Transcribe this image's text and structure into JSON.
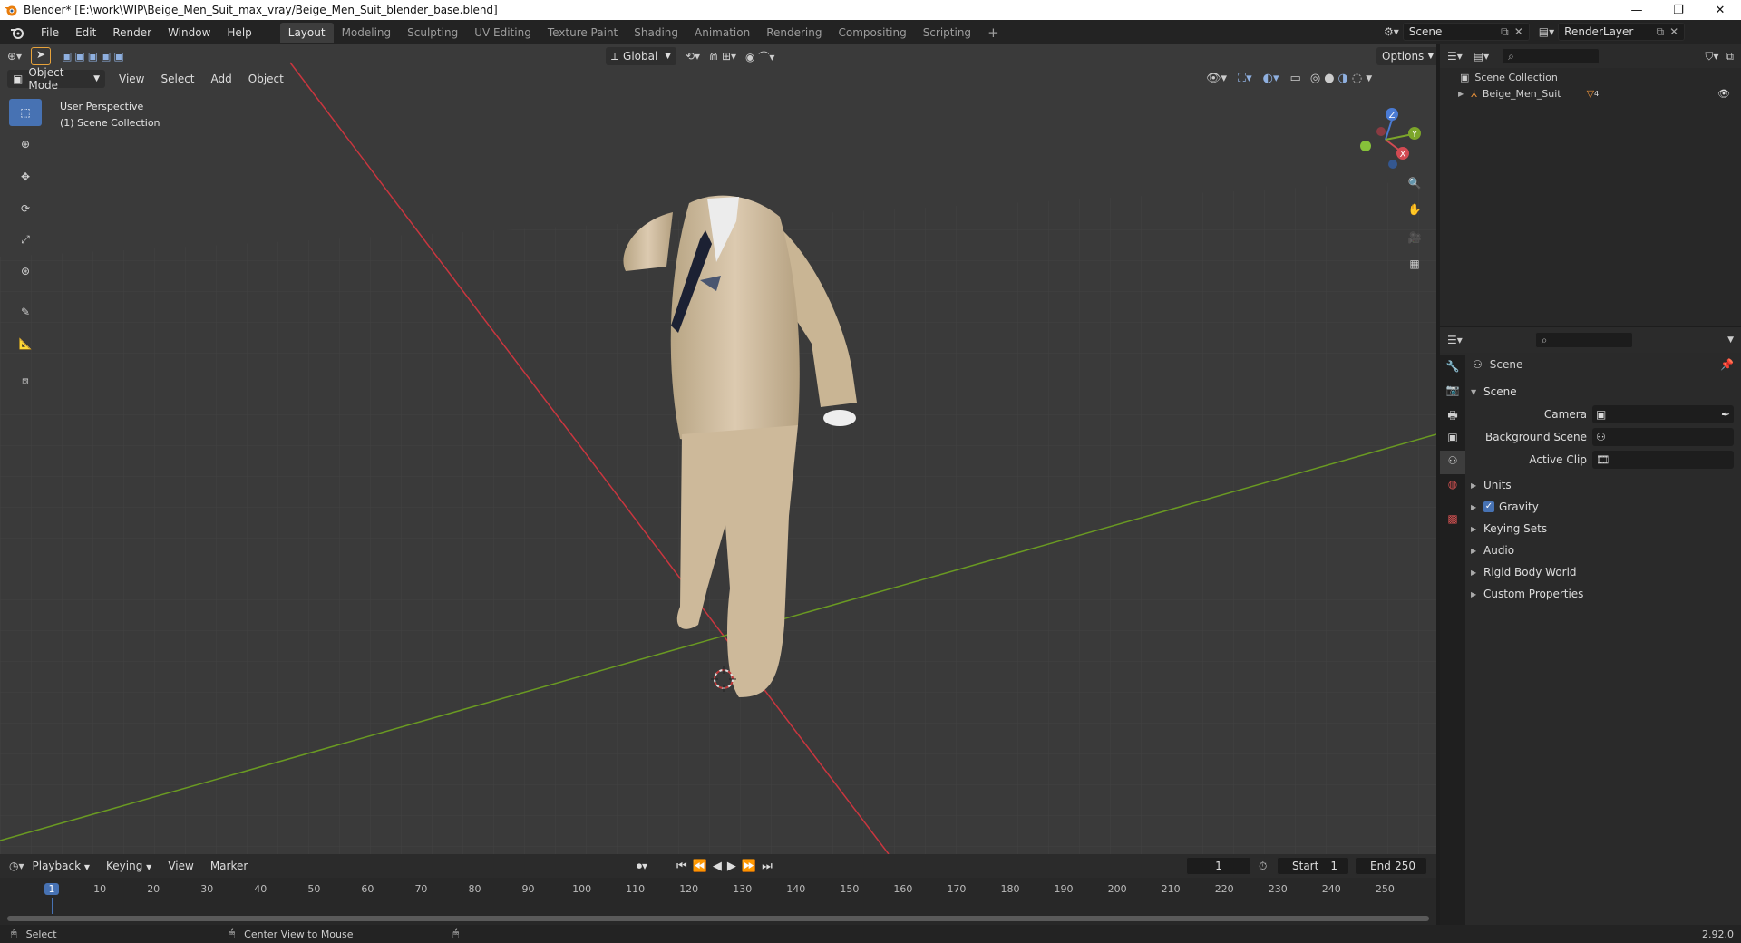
{
  "window": {
    "title": "Blender* [E:\\work\\WIP\\Beige_Men_Suit_max_vray/Beige_Men_Suit_blender_base.blend]",
    "controls": [
      "—",
      "❐",
      "✕"
    ]
  },
  "menu": [
    "File",
    "Edit",
    "Render",
    "Window",
    "Help"
  ],
  "workspaces": [
    {
      "label": "Layout",
      "active": true
    },
    {
      "label": "Modeling",
      "active": false
    },
    {
      "label": "Sculpting",
      "active": false
    },
    {
      "label": "UV Editing",
      "active": false
    },
    {
      "label": "Texture Paint",
      "active": false
    },
    {
      "label": "Shading",
      "active": false
    },
    {
      "label": "Animation",
      "active": false
    },
    {
      "label": "Rendering",
      "active": false
    },
    {
      "label": "Compositing",
      "active": false
    },
    {
      "label": "Scripting",
      "active": false
    }
  ],
  "add_workspace": "+",
  "scene_selector": "Scene",
  "render_layer": "RenderLayer",
  "viewport": {
    "mode": "Object Mode",
    "menus": [
      "View",
      "Select",
      "Add",
      "Object"
    ],
    "orientation": "Global",
    "options": "Options",
    "overlay_title": "User Perspective",
    "overlay_collection": "(1) Scene Collection",
    "gizmo_axes": {
      "x": "X",
      "y": "Y",
      "z": "Z"
    },
    "colors": {
      "bg": "#3a3a3a",
      "x_axis": "#c9363f",
      "y_axis": "#6a9a22",
      "suit": "#d8c4a4"
    },
    "tools": [
      "select-box-icon",
      "cursor-icon",
      "move-icon",
      "rotate-icon",
      "scale-icon",
      "transform-icon",
      "annotate-icon",
      "measure-icon",
      "add-cube-icon"
    ]
  },
  "outliner": {
    "root": "Scene Collection",
    "items": [
      {
        "label": "Beige_Men_Suit",
        "badge": "4"
      }
    ]
  },
  "properties": {
    "context": "Scene",
    "panel_title": "Scene",
    "fields": [
      {
        "label": "Camera",
        "value": ""
      },
      {
        "label": "Background Scene",
        "value": ""
      },
      {
        "label": "Active Clip",
        "value": ""
      }
    ],
    "subpanels": [
      {
        "label": "Units",
        "checkbox": false
      },
      {
        "label": "Gravity",
        "checkbox": true
      },
      {
        "label": "Keying Sets",
        "checkbox": false
      },
      {
        "label": "Audio",
        "checkbox": false
      },
      {
        "label": "Rigid Body World",
        "checkbox": false
      },
      {
        "label": "Custom Properties",
        "checkbox": false
      }
    ]
  },
  "timeline": {
    "menus": [
      "Playback",
      "Keying",
      "View",
      "Marker"
    ],
    "current_frame": "1",
    "start_label": "Start",
    "start": "1",
    "end_label": "End",
    "end": "250",
    "ruler": [
      "1",
      "10",
      "20",
      "30",
      "40",
      "50",
      "60",
      "70",
      "80",
      "90",
      "100",
      "110",
      "120",
      "130",
      "140",
      "150",
      "160",
      "170",
      "180",
      "190",
      "200",
      "210",
      "220",
      "230",
      "240",
      "250"
    ]
  },
  "status": {
    "left": "Select",
    "middle": "Center View to Mouse",
    "version": "2.92.0"
  }
}
